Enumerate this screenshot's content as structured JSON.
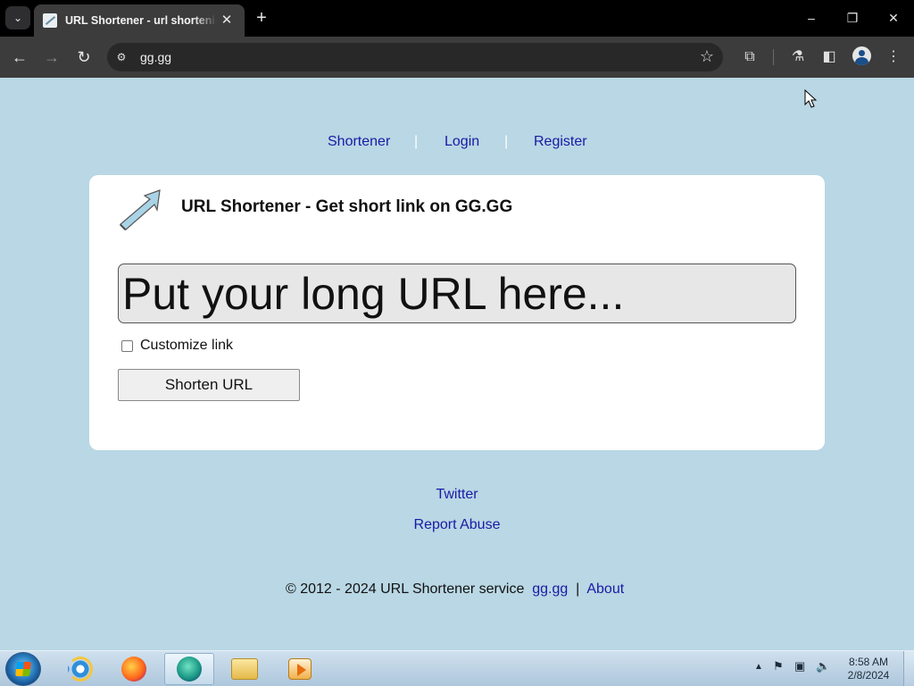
{
  "browser": {
    "tab_title": "URL Shortener - url shortening",
    "tab_close": "✕",
    "new_tab": "+",
    "address": "gg.gg",
    "window_controls": {
      "minimize": "–",
      "restore": "❐",
      "close": "✕"
    }
  },
  "nav": {
    "items": [
      {
        "label": "Shortener"
      },
      {
        "label": "Login"
      },
      {
        "label": "Register"
      }
    ],
    "separator": "|"
  },
  "card": {
    "title": "URL Shortener - Get short link on GG.GG",
    "url_placeholder": "Put your long URL here...",
    "customize_label": "Customize link",
    "customize_checked": false,
    "shorten_button": "Shorten URL"
  },
  "footer": {
    "twitter": "Twitter",
    "report_abuse": "Report Abuse",
    "copyright": "© 2012 - 2024 URL Shortener service",
    "site_link": "gg.gg",
    "separator": "|",
    "about": "About"
  },
  "taskbar": {
    "apps": [
      "internet-explorer",
      "firefox",
      "edge-browser",
      "file-explorer",
      "media-player"
    ],
    "active_app": "edge-browser",
    "time": "8:58 AM",
    "date": "2/8/2024"
  },
  "colors": {
    "page_background": "#b9d7e4",
    "link": "#1a1aa6",
    "card": "#ffffff"
  }
}
